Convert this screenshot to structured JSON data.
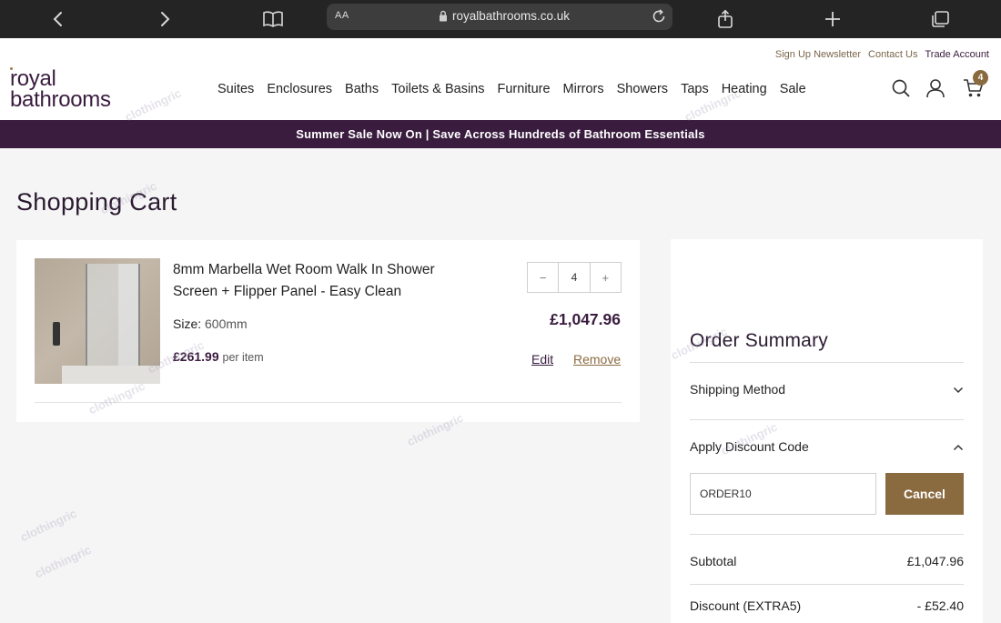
{
  "browser": {
    "aa_label": "AA",
    "url": "royalbathrooms.co.uk"
  },
  "header": {
    "top_links": [
      "Sign Up Newsletter",
      "Contact Us",
      "Trade Account"
    ],
    "logo_line1": "royal",
    "logo_line2": "bathrooms",
    "nav": [
      "Suites",
      "Enclosures",
      "Baths",
      "Toilets & Basins",
      "Furniture",
      "Mirrors",
      "Showers",
      "Taps",
      "Heating",
      "Sale"
    ],
    "cart_count": "4"
  },
  "promo": "Summer Sale Now On | Save Across Hundreds of Bathroom Essentials",
  "page_title": "Shopping Cart",
  "cart_item": {
    "name": "8mm Marbella Wet Room Walk In Shower Screen + Flipper Panel - Easy Clean",
    "size_label": "Size:",
    "size_value": "600mm",
    "unit_price": "£261.99",
    "per_item": "per item",
    "qty_minus": "−",
    "qty_value": "4",
    "qty_plus": "+",
    "line_total": "£1,047.96",
    "edit_label": "Edit",
    "remove_label": "Remove"
  },
  "summary": {
    "title": "Order Summary",
    "shipping_label": "Shipping Method",
    "discount_label": "Apply Discount Code",
    "discount_value": "ORDER10",
    "cancel_label": "Cancel",
    "subtotal_label": "Subtotal",
    "subtotal_value": "£1,047.96",
    "discount_row_label": "Discount (EXTRA5)",
    "discount_row_value": "- £52.40"
  },
  "watermark": "clothingric",
  "colors": {
    "brand_purple": "#3a1c3f",
    "brand_gold": "#8a6a3f"
  }
}
